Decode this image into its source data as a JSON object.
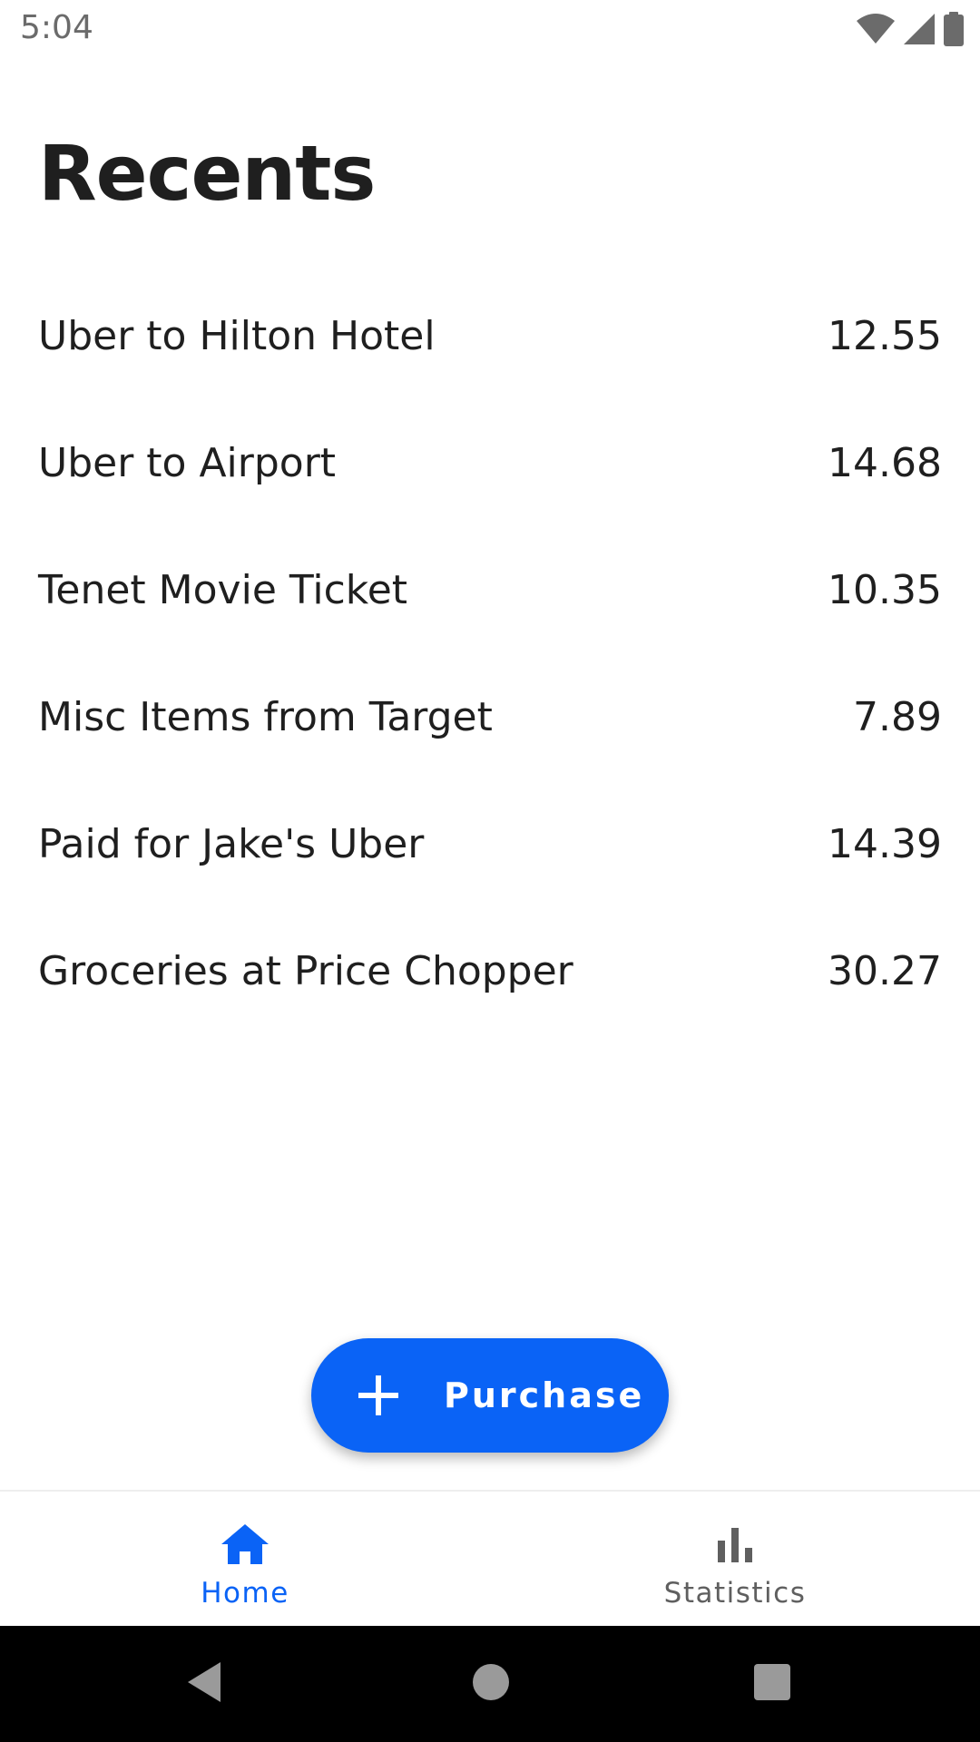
{
  "status_bar": {
    "time": "5:04"
  },
  "page": {
    "title": "Recents"
  },
  "purchases": [
    {
      "description": "Uber to Hilton Hotel",
      "amount": "12.55"
    },
    {
      "description": "Uber to Airport",
      "amount": "14.68"
    },
    {
      "description": "Tenet Movie Ticket",
      "amount": "10.35"
    },
    {
      "description": "Misc Items from Target",
      "amount": "7.89"
    },
    {
      "description": "Paid for Jake's Uber",
      "amount": "14.39"
    },
    {
      "description": "Groceries at Price Chopper",
      "amount": "30.27"
    }
  ],
  "fab": {
    "icon": "plus-icon",
    "label": "Purchase"
  },
  "bottom_nav": {
    "items": [
      {
        "label": "Home",
        "icon": "home-icon",
        "active": true
      },
      {
        "label": "Statistics",
        "icon": "bar-chart-icon",
        "active": false
      }
    ]
  },
  "colors": {
    "accent": "#0a63f6",
    "text": "#1f1f1f",
    "inactive": "#5f5f5f"
  }
}
